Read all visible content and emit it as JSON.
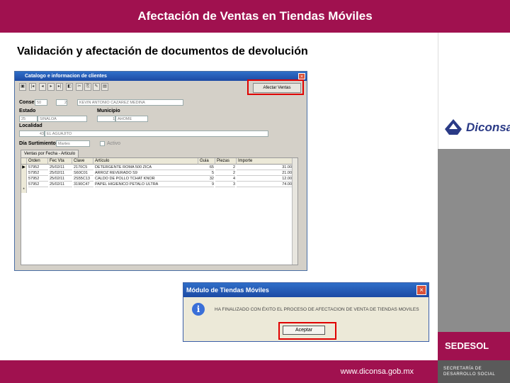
{
  "header": {
    "title": "Afectación de Ventas en Tiendas Móviles"
  },
  "subtitle": "Validación y afectación de documentos de devolución",
  "branding": {
    "diconsa": "Diconsa",
    "sedesol": "SEDESOL",
    "sedesol_sub": "SECRETARÍA DE DESARROLLO SOCIAL",
    "url": "www.diconsa.gob.mx"
  },
  "window1": {
    "title": "Catalogo e informacion de clientes",
    "close": "×",
    "afectar_label": "Afectar Ventas",
    "conse_label": "Conse:",
    "conse_value": "50",
    "conse_num": "2",
    "client_name": "KEVIN ANTONIO CAZAREZ MEDINA",
    "estado_label": "Estado",
    "estado_code": "25",
    "estado_value": "SINALOA",
    "municipio_label": "Municipio",
    "municipio_code": "1",
    "municipio_value": "AHOME",
    "localidad_label": "Localidad",
    "localidad_code": "43",
    "localidad_value": "EL AGUAJITO",
    "dia_label": "Día Surtimiento",
    "dia_value": "Martes",
    "activo_label": "Activo",
    "tab_label": "Ventas por Fecha - Articulo",
    "columns": [
      "Orden",
      "Fec Vta",
      "Clave",
      "Artículo",
      "Guia",
      "Piezas",
      "Importe"
    ],
    "rows": [
      [
        "57952",
        "25/02/11",
        "2170C5",
        "DETERGENTE ROMA 500 ZICA",
        "65",
        "2",
        "31.00"
      ],
      [
        "57952",
        "25/02/11",
        "S60C01",
        "ARROZ REVERADO S9",
        "5",
        "2",
        "21.00"
      ],
      [
        "57952",
        "25/02/11",
        "2S55C13",
        "CALDO DE POLLO TCHAT KNOR",
        "32",
        "4",
        "12.00"
      ],
      [
        "57952",
        "25/02/11",
        "3190C47",
        "PAPEL HIGIENICO PETALO ULTRA",
        "9",
        "3",
        "74.00"
      ]
    ],
    "new_row_marker": "*",
    "current_row_marker": "▶"
  },
  "window2": {
    "title": "Módulo de Tiendas Móviles",
    "close": "×",
    "icon_glyph": "i",
    "message": "HA FINALIZADO CON ÉXITO EL PROCESO DE AFECTACION DE VENTA DE TIENDAS MOVILES",
    "ok_label": "Aceptar"
  },
  "toolbar": [
    "▣",
    "|◂",
    "◂",
    "▸",
    "▸|",
    "◧",
    "✂",
    "⎘",
    "✎",
    "▤"
  ],
  "colors": {
    "brand": "#a0114f",
    "accent_red": "#e00000",
    "titlebar": "#1c4aa4"
  }
}
